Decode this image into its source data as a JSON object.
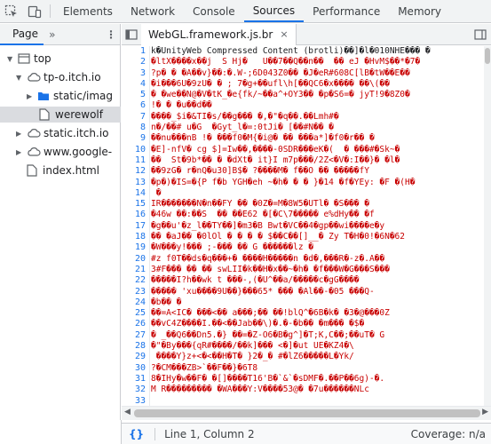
{
  "toolbar": {
    "tabs": [
      {
        "label": "Elements"
      },
      {
        "label": "Network"
      },
      {
        "label": "Console"
      },
      {
        "label": "Sources"
      },
      {
        "label": "Performance"
      },
      {
        "label": "Memory"
      }
    ],
    "active_tab": "Sources"
  },
  "navigator": {
    "tab_label": "Page",
    "more_label": "»",
    "tree": [
      {
        "label": "top"
      },
      {
        "label": "tp-o.itch.io"
      },
      {
        "label": "static/imag"
      },
      {
        "label": "werewolf"
      },
      {
        "label": "static.itch.io"
      },
      {
        "label": "www.google-"
      },
      {
        "label": "index.html"
      }
    ]
  },
  "editor": {
    "file_tab": "WebGL.framework.js.br",
    "close_glyph": "×",
    "line_numbers": [
      "1",
      "2",
      "3",
      "4",
      "5",
      "6",
      "7",
      "8",
      "9",
      "10",
      "11",
      "12",
      "13",
      "14",
      "15",
      "16",
      "17",
      "18",
      "19",
      "20",
      "21",
      "22",
      "23",
      "24",
      "25",
      "26",
      "27",
      "28",
      "29",
      "30",
      "31",
      "32",
      "33"
    ],
    "lines": [
      "k̊\u0000UnityWeb Compressed Content (brotli)\u0000\u0000]\u0000l\u0000010NHE\u0000\u0000\u0000 \u0000",
      "\u0000ltX\u0000\u0000\u0000\u0000x\u0000\u0000j  S Hj\u0000   U\u0000\u00007\u0000\u0000Q\u0000\u0000n\u0000\u0000  \u0000\u0000 eJ \u0000HvM$\u0000\u0000*\u00007\u0000",
      "?p\u0000 \u0000 \u0000A\u0000\u0000v}\u0000\u0000:\u0000.W-;6D043Z0\u0000\u0000 \u0000J\u0000eR#608C[lB\u0000tW\u0000\u0000E\u0000\u0000",
      "\u0000i\u0000\u0000\u00006U\u00009zU\u0000 \u0000 ; 7\u0000g+\u0000\u0000ufl\\h[\u0000\u0000QC6\u0000x\u0000\u0000\u0000\u0000 \u0000\u0000\\(\u0000\u0000",
      "\u0000 \u0000we\u0000\u0000N@\u0000V\u0000tK_\u0000e{fk/~\u0000\u0000a^+OY3\u0000\u0000 \u0000p\u0000S6=\u0000 jyT!9\u00008Z0\u0000",
      "!\u0000 \u0000 \u0000u\u0000\u0000d\u0000\u0000",
      "\u0000\u0000\u0000\u0000_$i\u0000&TI\u0000s/\u0000\u0000g\u0000\u0000\u0000 \u0000,\u0000\"\u0000q\u0000\u0000.\u0000\u0000Lmh#\u0000",
      "n\u0000/\u0000\u0000# u\u0000G  \u0000Gyt_l\u0000=:0tJi\u0000 [\u0000\u0000#N\u0000\u0000 \u0000",
      "\u0000\u0000nu\u0000\u0000\u0000nB !\u0000 \u0000\u0000\u0000f0\u0000M{\u0000i@\u0000 \u0000\u0000 \u0000\u0000\u0000a*]\u0000f0\u0000r\u0000\u0000 \u0000",
      "\u0000E]-nfV\u0000 cg $]=Iw\u0000\u0000,\u0000\u0000\u0000\u0000-0SDR\u0000\u0000\u0000eK\u0000(  \u0000 \u0000\u0000\u0000#\u0000Sk~\u0000",
      "\u0000\u0000  St\u00009b*\u0000\u0000 \u0000 \u0000dXt\u0000 it}I m7p\u0000\u0000\u0000/2Z<\u0000V\u0000:I\u0000\u0000}\u0000 \u0000l\u0000",
      "\u0000\u00009zG\u0000 r\u0000nQ\u0000u30]B$\u0000 ?\u0000\u0000\u0000\u0000M\u0000 f\u0000\u0000O \u0000\u0000 \u0000\u0000\u0000\u0000\u0000fY",
      "\u0000p\u0000)\u0000IS=\u0000{P f\u0000b YGH\u0000eh ~\u0000h\u0000 \u0000 \u0000 }\u000014 \u0000f\u0000YEy: \u0000F \u0000(H\u0000",
      " \u0000",
      "IR\u0000\u0000\u0000\u0000\u0000\u0000\u0000N\u0000n\u0000\u0000FY \u0000\u0000 \u00000Z\u0000=M\u00008W5\u0000UTl\u0000 \u0000S\u0000\u0000\u0000 \u0000",
      "\u000046w \u0000\u0000:\u0000\u0000S  \u0000\u0000 \u0000\u0000E62 \u0000[\u0000C\\7\u0000\u0000\u0000\u0000\u0000 e%dHy\u0000\u0000 \u0000f ",
      "\u0000g\u0000\u0000u'\u0000z_l\u0000\u0000TY\u0000\u0000]\u0000m3\u0000B Bwt\u0000VC\u0000\u00004\u0000gp\u0000\u0000wi\u0000\u0000\u0000\u0000e\u0000y",
      "\u0000\u0000 \u0000aJ\u0000\u0000 \u00000lOl \u0000 \u0000 \u0000 \u0000 $\u0000\u0000C\u0000\u0000[]__\u0000 Zy T\u0000H\u00000!\u00006N\u000062 ",
      "\u0000W\u0000\u0000\u0000y!\u0000\u0000\u0000 ;-\u0000\u0000\u0000 \u0000\u0000 G \u0000\u0000\u0000\u0000\u0000\u0000lz \u0000",
      "#z f0T\u0000\u0000ds\u0000q\u0000\u0000\u0000+\u0000 \u0000\u0000\u0000\u0000H\u0000\u0000\u0000\u0000\u0000n \u0000d\u0000,\u0000\u0000\u0000R\u0000-z\u0000.A\u0000\u0000",
      "3#F\u0000\u0000\u0000 \u0000\u0000 \u0000\u0000 swLII\u0000k\u0000\u0000H\u0000x\u0000\u0000~\u0000h\u0000 \u0000f\u0000\u0000\u0000W\u0000G\u0000\u0000\u0000S\u0000\u0000\u0000",
      "\u0000\u0000\u0000\u0000\u0000I?h\u0000\u0000wk t \u0000\u0000\u0000-,(\u0000U^\u0000\u0000a/\u0000\u0000\u0000\u0000\u0000c\u0000gG\u0000\u0000\u0000\u0000",
      "\u0000\u0000\u0000\u0000\u0000 'xu\u0000\u0000\u0000\u00009U\u0000\u0000}\u0000\u0000\u000065* \u0000\u0000\u0000 \u0000Al\u0000\u0000-\u000005 \u0000\u0000\u0000Q-",
      "\u0000b\u0000\u0000 \u0000",
      "\u0000\u0000=A<IC\u0000 \u0000\u0000\u0000<\u0000\u0000 a\u0000\u0000\u0000;\u0000\u0000 \u0000\u0000!blQ^\u00006B\u0000k\u0000 \u00003\u0000@\u0000\u0000\u00000Z",
      "\u0000\u0000vC4Z\u0000\u0000\u0000\u0000I.\u0000\u0000<\u0000\u0000Jab\u0000\u0000\\)\u0000.\u0000-\u0000b\u0000\u0000 \u0000m\u0000\u0000\u0000 \u0000$\u0000",
      "\u0000 _\u0000\u0000Q6\u0000\u0000Dn5.\u0000} \u0000\u0000=\u0000Z-O6\u0000B\u0000g^]\u0000T;K,C\u0000\u0000;\u0000\u0000uT\u0000 G",
      "\u0000\"\u0000By\u0000\u0000\u0000{qR#\u0000\u0000\u0000\u0000/\u0000\u0000k]\u0000\u0000\u0000 <\u0000]\u0000ut UE\u0000KZ4\u0000\\",
      " \u0000\u0000\u0000\u0000Y}z+<\u0000<\u0000\u0000H\u0000T\u0000 }2\u0000_\u0000 #\u0000lZ6\u0000\u0000\u0000\u0000\u0000L\u0000Yk/",
      "?\u0000CM\u0000\u0000\u0000ZB>`\u0000\u0000F\u0000\u0000}\u00006T8",
      "8\u0000IHy\u0000w\u0000\u0000F\u0000 \u0000[]\u0000\u0000\u0000\u0000T16'B\u0000`&`\u0000sDMF\u0000.\u0000\u0000P\u0000\u00006g)-\u0000.",
      "M R\u0000\u0000\u0000\u0000\u0000\u0000\u0000\u0000\u0000 \u0000WA\u0000\u0000\u0000Y:V\u0000\u0000\u0000\u000053@\u0000 \u00007u\u0000\u0000\u0000\u0000\u0000\u0000NLc",
      ""
    ]
  },
  "status": {
    "braces": "{}",
    "position": "Line 1, Column 2",
    "coverage": "Coverage: n/a"
  }
}
